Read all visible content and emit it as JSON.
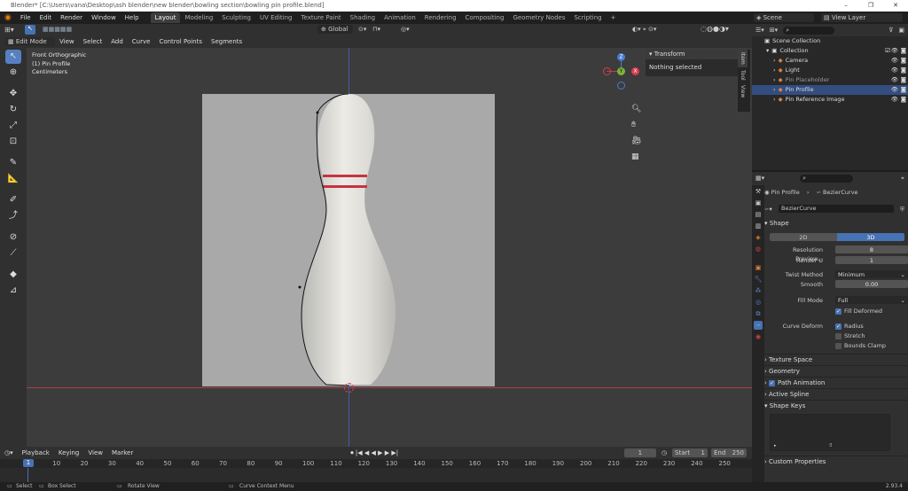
{
  "titlebar": {
    "title": "Blender* [C:\\Users\\vana\\Desktop\\ash blender\\new blender\\bowling section\\bowling pin profile.blend]",
    "min": "–",
    "max": "❐",
    "close": "✕"
  },
  "menus": [
    "File",
    "Edit",
    "Render",
    "Window",
    "Help"
  ],
  "workspaces": [
    "Layout",
    "Modeling",
    "Sculpting",
    "UV Editing",
    "Texture Paint",
    "Shading",
    "Animation",
    "Rendering",
    "Compositing",
    "Geometry Nodes",
    "Scripting"
  ],
  "workspace_add": "+",
  "scene": {
    "label": "Scene",
    "view_layer": "View Layer"
  },
  "vp_header": {
    "mode": "Edit Mode",
    "menus": [
      "View",
      "Select",
      "Add",
      "Curve",
      "Control Points",
      "Segments"
    ],
    "orientation": "Global"
  },
  "vp_overlay": {
    "line1": "Front Orthographic",
    "line2": "(1) Pin Profile",
    "line3": "Centimeters"
  },
  "gizmo": {
    "x": "X",
    "y": "Y",
    "z": "Z"
  },
  "npanel": {
    "title": "Transform",
    "text": "Nothing selected",
    "tabs": [
      "Item",
      "Tool",
      "View"
    ]
  },
  "timeline": {
    "menus": [
      "Playback",
      "Keying",
      "View",
      "Marker"
    ],
    "current_frame": "1",
    "start_label": "Start",
    "start": "1",
    "end_label": "End",
    "end": "250",
    "ruler": [
      "1",
      "10",
      "20",
      "30",
      "40",
      "50",
      "60",
      "70",
      "80",
      "90",
      "100",
      "110",
      "120",
      "130",
      "140",
      "150",
      "160",
      "170",
      "180",
      "190",
      "200",
      "210",
      "220",
      "230",
      "240",
      "250"
    ]
  },
  "statusbar": {
    "select": "Select",
    "box": "Box Select",
    "rotate": "Rotate View",
    "menu": "Curve Context Menu",
    "version": "2.93.4"
  },
  "outliner": {
    "root": "Scene Collection",
    "collection": "Collection",
    "items": [
      {
        "name": "Camera",
        "icon": "camera-icon",
        "color": "#e0823a",
        "selected": false
      },
      {
        "name": "Light",
        "icon": "light-icon",
        "color": "#e0823a",
        "selected": false
      },
      {
        "name": "Pin Placeholder",
        "icon": "empty-icon",
        "color": "#e0823a",
        "selected": false
      },
      {
        "name": "Pin Profile",
        "icon": "curve-icon",
        "color": "#e0823a",
        "selected": true
      },
      {
        "name": "Pin Reference Image",
        "icon": "image-icon",
        "color": "#e0823a",
        "selected": false
      }
    ]
  },
  "props": {
    "object": "Pin Profile",
    "data": "BezierCurve",
    "datablock": "BezierCurve",
    "shape_title": "Shape",
    "dim2": "2D",
    "dim3": "3D",
    "res_preview_label": "Resolution Preview...",
    "res_preview": "8",
    "render_u_label": "Render U",
    "render_u": "1",
    "twist_label": "Twist Method",
    "twist": "Minimum",
    "smooth_label": "Smooth",
    "smooth": "0.00",
    "fill_label": "Fill Mode",
    "fill": "Full",
    "fill_deformed": "Fill Deformed",
    "curve_deform_label": "Curve Deform",
    "radius": "Radius",
    "stretch": "Stretch",
    "bounds": "Bounds Clamp",
    "sections": [
      "Texture Space",
      "Geometry",
      "Path Animation",
      "Active Spline",
      "Shape Keys"
    ],
    "custom": "Custom Properties"
  },
  "colors": {
    "accent": "#4772b3",
    "selected": "#334d80",
    "pin_band": "#c83240"
  }
}
